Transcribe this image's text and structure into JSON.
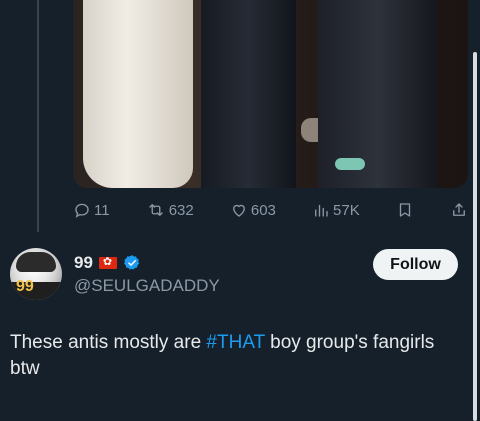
{
  "media": {
    "icon": "photo"
  },
  "actions": {
    "replies": "11",
    "retweets": "632",
    "likes": "603",
    "views": "57K"
  },
  "reply_tweet": {
    "display_name": "99",
    "flag_icon": "hong-kong-flag-icon",
    "verified_icon": "verified-badge-icon",
    "handle": "@SEULGADADDY",
    "follow_label": "Follow",
    "avatar_number": "99",
    "text_before": "These antis mostly are ",
    "hashtag": "#THAT",
    "text_after": " boy group's fangirls btw"
  },
  "colors": {
    "background": "#15202b",
    "accent": "#1d9bf0",
    "muted": "#8b98a5",
    "text": "#e7e9ea"
  }
}
